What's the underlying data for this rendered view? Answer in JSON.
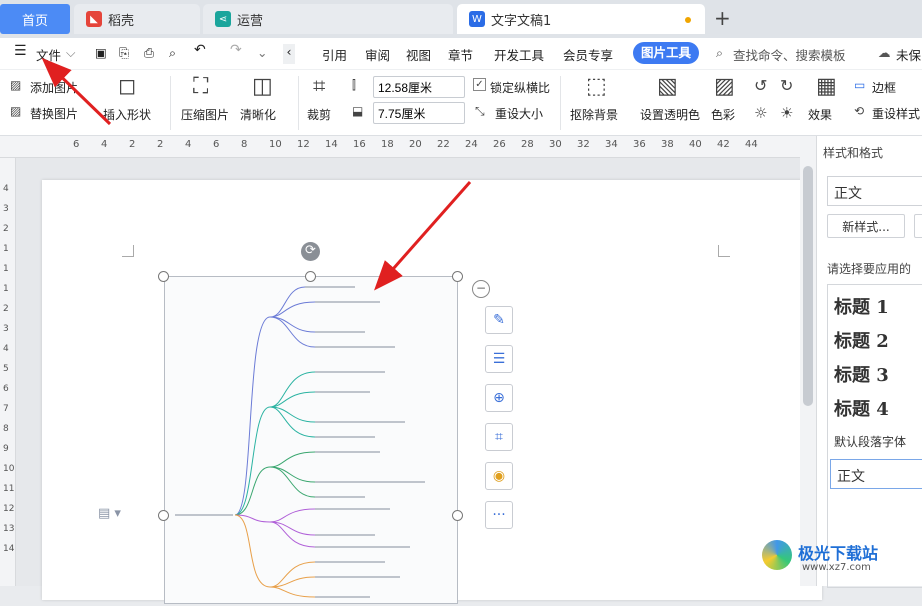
{
  "tabs": {
    "home": "首页",
    "t1": "稻壳",
    "t2": "运营",
    "t3": "文字文稿1"
  },
  "menu": {
    "file": "文件",
    "items": [
      "引用",
      "审阅",
      "视图",
      "章节",
      "开发工具",
      "会员专享"
    ],
    "picture_tools": "图片工具",
    "search": "查找命令、搜索模板",
    "save": "未保"
  },
  "ribbon": {
    "add_pic": "添加图片",
    "replace_pic": "替换图片",
    "insert_shape": "插入形状",
    "compress": "压缩图片",
    "sharpen": "清晰化",
    "crop": "裁剪",
    "width": "12.58厘米",
    "height": "7.75厘米",
    "lock_ratio": "锁定纵横比",
    "reset_size": "重设大小",
    "remove_bg": "抠除背景",
    "transparent": "设置透明色",
    "color": "色彩",
    "effects": "效果",
    "border": "边框",
    "reset_style": "重设样式"
  },
  "ruler": {
    "top": [
      "6",
      "4",
      "2",
      "2",
      "4",
      "6",
      "8",
      "10",
      "12",
      "14",
      "16",
      "18",
      "20",
      "22",
      "24",
      "26",
      "28",
      "30",
      "32",
      "34",
      "36",
      "38",
      "40",
      "42",
      "44"
    ],
    "left": [
      "4",
      "3",
      "2",
      "1",
      "1",
      "1",
      "2",
      "3",
      "4",
      "5",
      "6",
      "7",
      "8",
      "9",
      "10",
      "11",
      "12",
      "13",
      "14"
    ]
  },
  "panel": {
    "title": "样式和格式",
    "current": "正文",
    "new_style": "新样式...",
    "apply_label": "请选择要应用的",
    "styles": [
      "标题 1",
      "标题 2",
      "标题 3",
      "标题 4"
    ],
    "default_font": "默认段落字体",
    "bottom": "正文"
  },
  "watermark": {
    "text": "极光下载站",
    "url": "www.xz7.com"
  }
}
